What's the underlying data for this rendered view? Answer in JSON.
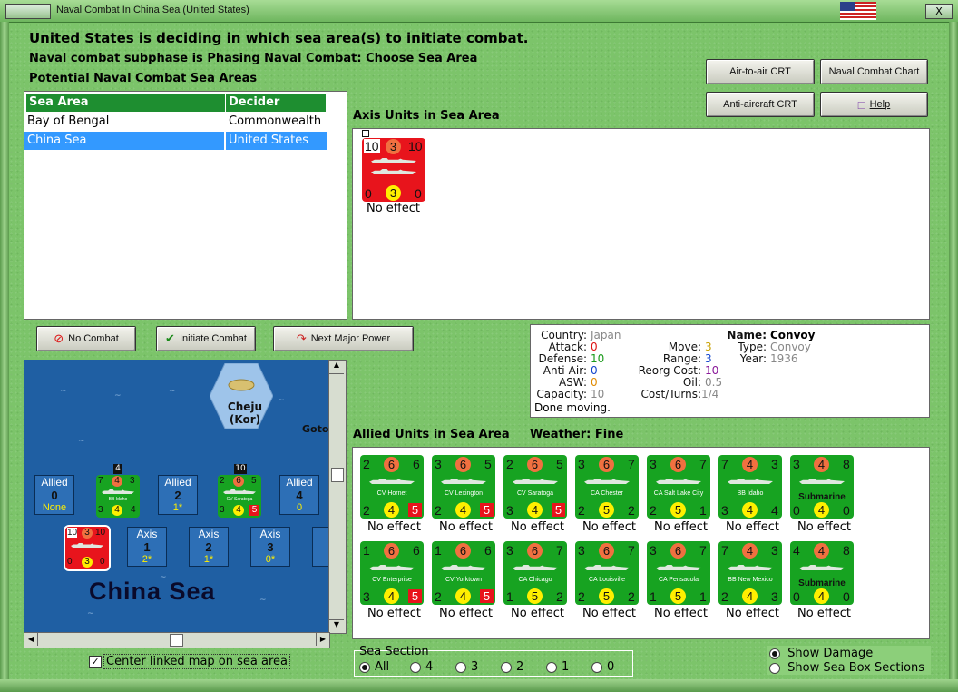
{
  "window": {
    "title": "Naval Combat In China Sea (United States)",
    "close_label": "X"
  },
  "header": {
    "line1": "United States is deciding in which sea area(s) to initiate combat.",
    "line2": "Naval combat subphase is Phasing Naval Combat: Choose Sea Area",
    "line3": "Potential Naval Combat Sea Areas"
  },
  "buttons": {
    "air_to_air": "Air-to-air CRT",
    "naval_chart": "Naval Combat Chart",
    "anti_aircraft": "Anti-aircraft CRT",
    "help": "Help",
    "no_combat": "No Combat",
    "initiate": "Initiate Combat",
    "next_major": "Next Major Power"
  },
  "sea_table": {
    "headers": [
      "Sea Area",
      "Decider"
    ],
    "rows": [
      {
        "area": "Bay of Bengal",
        "decider": "Commonwealth"
      },
      {
        "area": "China Sea",
        "decider": "United States"
      }
    ]
  },
  "axis": {
    "title": "Axis Units in Sea Area",
    "unit": {
      "tl": "10",
      "tm": "3",
      "tr": "10",
      "bl": "0",
      "bm": "3",
      "br": "0",
      "status": "No effect"
    }
  },
  "info": {
    "country_lbl": "Country:",
    "country": "Japan",
    "attack_lbl": "Attack:",
    "attack": "0",
    "defense_lbl": "Defense:",
    "defense": "10",
    "antiair_lbl": "Anti-Air:",
    "antiair": "0",
    "asw_lbl": "ASW:",
    "asw": "0",
    "capacity_lbl": "Capacity:",
    "capacity": "10",
    "moving": "Done moving.",
    "move_lbl": "Move:",
    "move": "3",
    "range_lbl": "Range:",
    "range": "3",
    "reorg_lbl": "Reorg Cost:",
    "reorg": "10",
    "oil_lbl": "Oil:",
    "oil": "0.5",
    "cost_lbl": "Cost/Turns:",
    "cost": "1/4",
    "name_lbl": "Name:",
    "name": "Convoy",
    "type_lbl": "Type:",
    "type": "Convoy",
    "year_lbl": "Year:",
    "year": "1936"
  },
  "allied": {
    "title": "Allied Units in Sea Area",
    "weather": "Weather:  Fine",
    "units": [
      {
        "name": "CV Hornet",
        "tl": "2",
        "tm": "6",
        "tr": "6",
        "bl": "2",
        "bm": "4",
        "br": "5",
        "red": true,
        "status": "No effect"
      },
      {
        "name": "CV Lexington",
        "tl": "3",
        "tm": "6",
        "tr": "5",
        "bl": "2",
        "bm": "4",
        "br": "5",
        "red": true,
        "status": "No effect"
      },
      {
        "name": "CV Saratoga",
        "tl": "2",
        "tm": "6",
        "tr": "5",
        "bl": "3",
        "bm": "4",
        "br": "5",
        "red": true,
        "status": "No effect"
      },
      {
        "name": "CA Chester",
        "tl": "3",
        "tm": "6",
        "tr": "7",
        "bl": "2",
        "bm": "5",
        "br": "2",
        "red": false,
        "status": "No effect"
      },
      {
        "name": "CA Salt Lake City",
        "tl": "3",
        "tm": "6",
        "tr": "7",
        "bl": "2",
        "bm": "5",
        "br": "1",
        "red": false,
        "status": "No effect"
      },
      {
        "name": "BB Idaho",
        "tl": "7",
        "tm": "4",
        "tr": "3",
        "bl": "3",
        "bm": "4",
        "br": "4",
        "red": false,
        "status": "No effect"
      },
      {
        "name": "Submarine",
        "tl": "3",
        "tm": "4",
        "tr": "8",
        "bl": "0",
        "bm": "4",
        "br": "0",
        "red": false,
        "big": true,
        "status": "No effect"
      },
      {
        "name": "CV Enterprise",
        "tl": "1",
        "tm": "6",
        "tr": "6",
        "bl": "3",
        "bm": "4",
        "br": "5",
        "red": true,
        "status": "No effect"
      },
      {
        "name": "CV Yorktown",
        "tl": "1",
        "tm": "6",
        "tr": "6",
        "bl": "2",
        "bm": "4",
        "br": "5",
        "red": true,
        "status": "No effect"
      },
      {
        "name": "CA Chicago",
        "tl": "3",
        "tm": "6",
        "tr": "7",
        "bl": "1",
        "bm": "5",
        "br": "2",
        "red": false,
        "status": "No effect"
      },
      {
        "name": "CA Louisville",
        "tl": "3",
        "tm": "6",
        "tr": "7",
        "bl": "2",
        "bm": "5",
        "br": "2",
        "red": false,
        "status": "No effect"
      },
      {
        "name": "CA Pensacola",
        "tl": "3",
        "tm": "6",
        "tr": "7",
        "bl": "1",
        "bm": "5",
        "br": "1",
        "red": false,
        "status": "No effect"
      },
      {
        "name": "BB New Mexico",
        "tl": "7",
        "tm": "4",
        "tr": "3",
        "bl": "2",
        "bm": "4",
        "br": "3",
        "red": false,
        "status": "No effect"
      },
      {
        "name": "Submarine",
        "tl": "4",
        "tm": "4",
        "tr": "8",
        "bl": "0",
        "bm": "4",
        "br": "0",
        "red": false,
        "big": true,
        "status": "No effect"
      }
    ]
  },
  "map": {
    "island": "Cheju (Kor)",
    "goto": "Goto",
    "sea_name": "China Sea",
    "allied_boxes": [
      {
        "label": "Allied",
        "num": "0",
        "sub": "None"
      },
      {
        "label": "Allied",
        "num": "2",
        "sub": "1*"
      },
      {
        "label": "Allied",
        "num": "4",
        "sub": "0"
      }
    ],
    "axis_boxes": [
      {
        "label": "Axis",
        "num": "1",
        "sub": "2*"
      },
      {
        "label": "Axis",
        "num": "2",
        "sub": "1*"
      },
      {
        "label": "Axis",
        "num": "3",
        "sub": "0*"
      },
      {
        "label": "A"
      }
    ],
    "stack1_count": "4",
    "stack2_count": "10",
    "stack1": {
      "tl": "7",
      "tm": "4",
      "tr": "3",
      "bl": "3",
      "bm": "4",
      "br": "4",
      "name": "BB Idaho"
    },
    "stack2": {
      "tl": "2",
      "tm": "6",
      "tr": "5",
      "bl": "3",
      "bm": "4",
      "br": "5",
      "name": "CV Saratoga"
    },
    "axis_stack": {
      "tl": "10",
      "tm": "3",
      "tr": "10",
      "bl": "0",
      "bm": "3",
      "br": "0"
    }
  },
  "center_map": {
    "label": "Center linked map on sea area",
    "checked": true
  },
  "sea_section": {
    "title": "Sea Section",
    "options": [
      "All",
      "4",
      "3",
      "2",
      "1",
      "0"
    ],
    "selected": "All"
  },
  "view_options": {
    "show_damage": "Show Damage",
    "show_sections": "Show Sea Box Sections"
  }
}
